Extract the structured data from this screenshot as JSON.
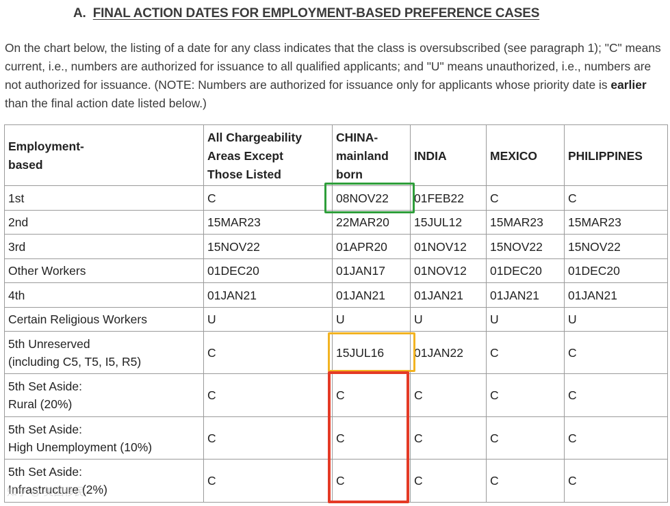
{
  "section": {
    "letter": "A.",
    "title": "FINAL ACTION DATES FOR EMPLOYMENT-BASED PREFERENCE CASES"
  },
  "intro": {
    "part1": "On the chart below, the listing of a date for any class indicates that the class is oversubscribed (see paragraph 1); \"C\" means current, i.e., numbers are authorized for issuance to all qualified applicants; and \"U\" means unauthorized, i.e., numbers are not authorized for issuance. (NOTE: Numbers are authorized for issuance only for applicants whose priority date is ",
    "emphasis": "earlier",
    "part2": " than the final action date listed below.)"
  },
  "table": {
    "headers": [
      [
        "Employment-",
        "based"
      ],
      [
        "All Chargeability",
        "Areas Except",
        "Those Listed"
      ],
      [
        "CHINA-",
        "mainland",
        "born"
      ],
      [
        "INDIA"
      ],
      [
        "MEXICO"
      ],
      [
        "PHILIPPINES"
      ]
    ],
    "rows": [
      {
        "category": [
          "1st"
        ],
        "values": [
          "C",
          "08NOV22",
          "01FEB22",
          "C",
          "C"
        ]
      },
      {
        "category": [
          "2nd"
        ],
        "values": [
          "15MAR23",
          "22MAR20",
          "15JUL12",
          "15MAR23",
          "15MAR23"
        ]
      },
      {
        "category": [
          "3rd"
        ],
        "values": [
          "15NOV22",
          "01APR20",
          "01NOV12",
          "15NOV22",
          "15NOV22"
        ]
      },
      {
        "category": [
          "Other Workers"
        ],
        "values": [
          "01DEC20",
          "01JAN17",
          "01NOV12",
          "01DEC20",
          "01DEC20"
        ]
      },
      {
        "category": [
          "4th"
        ],
        "values": [
          "01JAN21",
          "01JAN21",
          "01JAN21",
          "01JAN21",
          "01JAN21"
        ]
      },
      {
        "category": [
          "Certain Religious Workers"
        ],
        "values": [
          "U",
          "U",
          "U",
          "U",
          "U"
        ]
      },
      {
        "category": [
          "5th Unreserved",
          "(including C5, T5, I5, R5)"
        ],
        "values": [
          "C",
          "15JUL16",
          "01JAN22",
          "C",
          "C"
        ]
      },
      {
        "category": [
          "5th Set Aside:",
          "Rural (20%)"
        ],
        "values": [
          "C",
          "C",
          "C",
          "C",
          "C"
        ]
      },
      {
        "category": [
          "5th Set Aside:",
          "High Unemployment (10%)"
        ],
        "values": [
          "C",
          "C",
          "C",
          "C",
          "C"
        ]
      },
      {
        "category": [
          "5th Set Aside:",
          "Infrastructure (2%)"
        ],
        "values": [
          "C",
          "C",
          "C",
          "C",
          "C"
        ]
      }
    ]
  },
  "highlights": {
    "green": "#2e9e3a",
    "yellow": "#f2b321",
    "red": "#e43a26"
  },
  "watermark": "知乎 @ 美国移民"
}
